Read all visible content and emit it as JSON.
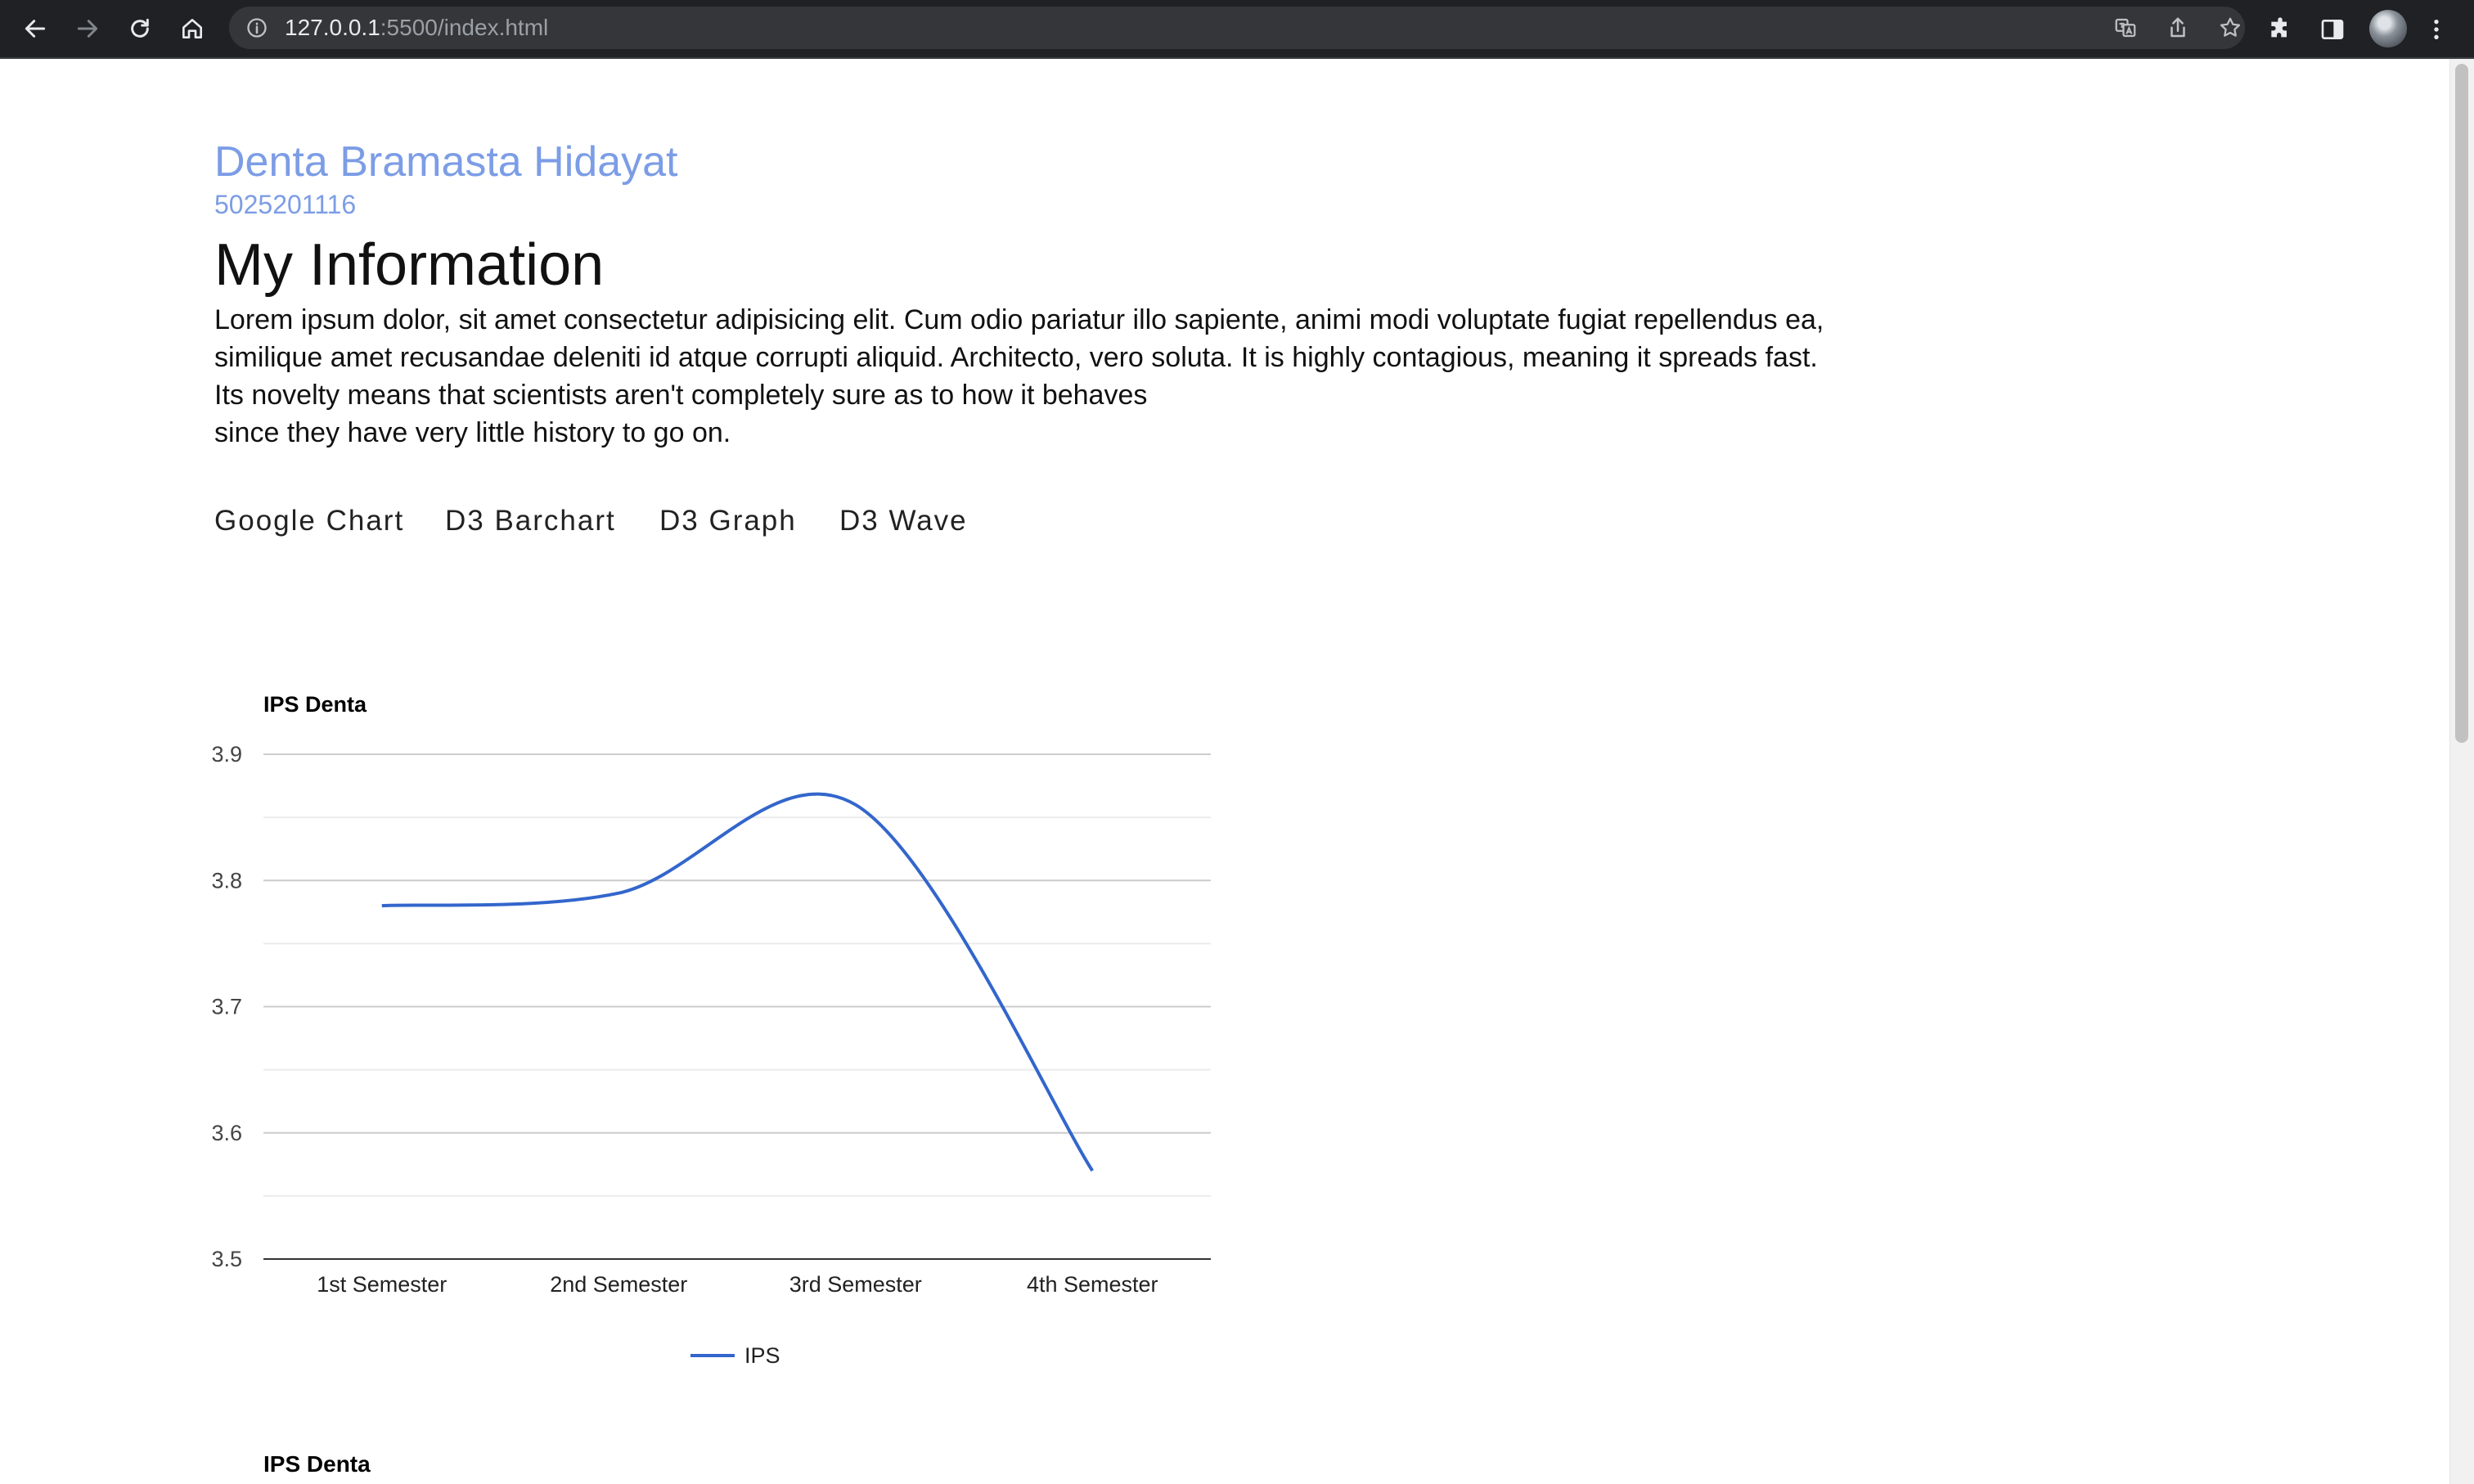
{
  "browser": {
    "url_host": "127.0.0.1",
    "url_rest": ":5500/index.html",
    "icons": [
      "back-icon",
      "forward-icon",
      "reload-icon",
      "home-icon",
      "site-info-icon",
      "translate-icon",
      "share-icon",
      "bookmark-star-icon",
      "extensions-icon",
      "side-panel-icon",
      "profile-avatar",
      "menu-icon"
    ]
  },
  "header": {
    "name": "Denta Bramasta Hidayat",
    "student_id": "5025201116",
    "title": "My Information"
  },
  "intro": {
    "lines": [
      "Lorem ipsum dolor, sit amet consectetur adipisicing elit. Cum odio pariatur illo sapiente, animi modi voluptate fugiat repellendus ea,",
      "similique amet recusandae deleniti id atque corrupti aliquid. Architecto, vero soluta. It is highly contagious, meaning it spreads fast.",
      "Its novelty means that scientists aren't completely sure as to how it behaves",
      "since they have very little history to go on."
    ]
  },
  "tabs": [
    {
      "label": "Google Chart"
    },
    {
      "label": "D3 Barchart"
    },
    {
      "label": "D3 Graph"
    },
    {
      "label": "D3 Wave"
    }
  ],
  "colors": {
    "accent": "#7c9de6",
    "series": "#3366cc",
    "chrome": "#202124"
  },
  "chart_data": [
    {
      "type": "line",
      "title": "IPS Denta",
      "categories": [
        "1st Semester",
        "2nd Semester",
        "3rd Semester",
        "4th Semester"
      ],
      "series": [
        {
          "name": "IPS",
          "values": [
            3.78,
            3.79,
            3.86,
            3.57
          ]
        }
      ],
      "ylim": [
        3.5,
        3.9
      ],
      "yticks": [
        "3.5",
        "3.6",
        "3.7",
        "3.8",
        "3.9"
      ],
      "curve": "smooth",
      "grid": true,
      "legend": "bottom"
    },
    {
      "title": "IPS Denta"
    }
  ]
}
